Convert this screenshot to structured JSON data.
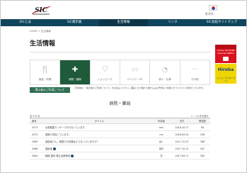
{
  "header": {
    "logo_text": "SIC",
    "flag_icon": "korea-flag-icon",
    "language": "한국어"
  },
  "nav": {
    "items": [
      {
        "label": "SICとは"
      },
      {
        "label": "SIC掲示板"
      },
      {
        "label": "生活情報"
      },
      {
        "label": "リンク"
      },
      {
        "label": "SIC会館サイトマップ"
      }
    ],
    "active_index": 2
  },
  "breadcrumb": "HOME > 生活情報",
  "page_title": "生活情報",
  "categories": [
    {
      "label": "食品・料理",
      "icon": "food-icon"
    },
    {
      "label": "病院・薬局",
      "icon": "hospital-icon"
    },
    {
      "label": "ショッピング",
      "icon": "shopping-icon"
    },
    {
      "label": "パソコン・PC",
      "icon": "computer-icon"
    },
    {
      "label": "求人・仕事",
      "icon": "work-icon"
    },
    {
      "label": "その他",
      "icon": "more-icon"
    }
  ],
  "active_category": 1,
  "guide": {
    "button_label": "掲示板のご利用について",
    "note": "ご利用前に「掲示板のご利用について」をお読みください。趣旨とかけ離れた書き込みは予告なく削除させていただく場合がございます。"
  },
  "section_title": "病院・薬局",
  "list_count": "全 572 件",
  "page_info": "1 ~ 10 件を表示",
  "table": {
    "headers": {
      "num": "番号",
      "title": "タイトル",
      "author": "作成者",
      "date": "日付",
      "views": "閲覧数"
    },
    "rows": [
      {
        "num": "4573",
        "title": "出張韓国マッサージを行なっています",
        "author": "ami",
        "date": "2018.10.17",
        "views": "90",
        "has_badge": false
      },
      {
        "num": "4572",
        "title": "産婦人科探しています。",
        "author": "mu",
        "date": "2018.04.24",
        "views": "226",
        "has_badge": false
      },
      {
        "num": "4569",
        "title": "歯医者さん、韓国での診療はどうなっていますか？",
        "author": "ぼく",
        "date": "2017.12.22",
        "views": "308",
        "has_badge": false
      },
      {
        "num": "4566",
        "title": "歯医者",
        "author": "田中",
        "date": "2017.10.12",
        "views": "407",
        "has_badge": true
      },
      {
        "num": "4564",
        "title": "韓国 歯科 矯正治療費用",
        "author": "花",
        "date": "2017.09.17",
        "views": "285",
        "has_badge": true
      }
    ]
  },
  "banners": {
    "youtube": {
      "text": "Hiroba YOUTUBE Channel OPEN!!",
      "icon": "youtube-play-icon"
    },
    "hiroba": {
      "name": "Hiroba",
      "sub": "リニューアルオープン!"
    }
  },
  "colors": {
    "nav_bg": "#10465d",
    "active_category_bg": "#1f5a3b",
    "guide_button_bg": "#2f6f52",
    "banner_red": "#d9121e",
    "banner_yellow": "#f0d600"
  }
}
